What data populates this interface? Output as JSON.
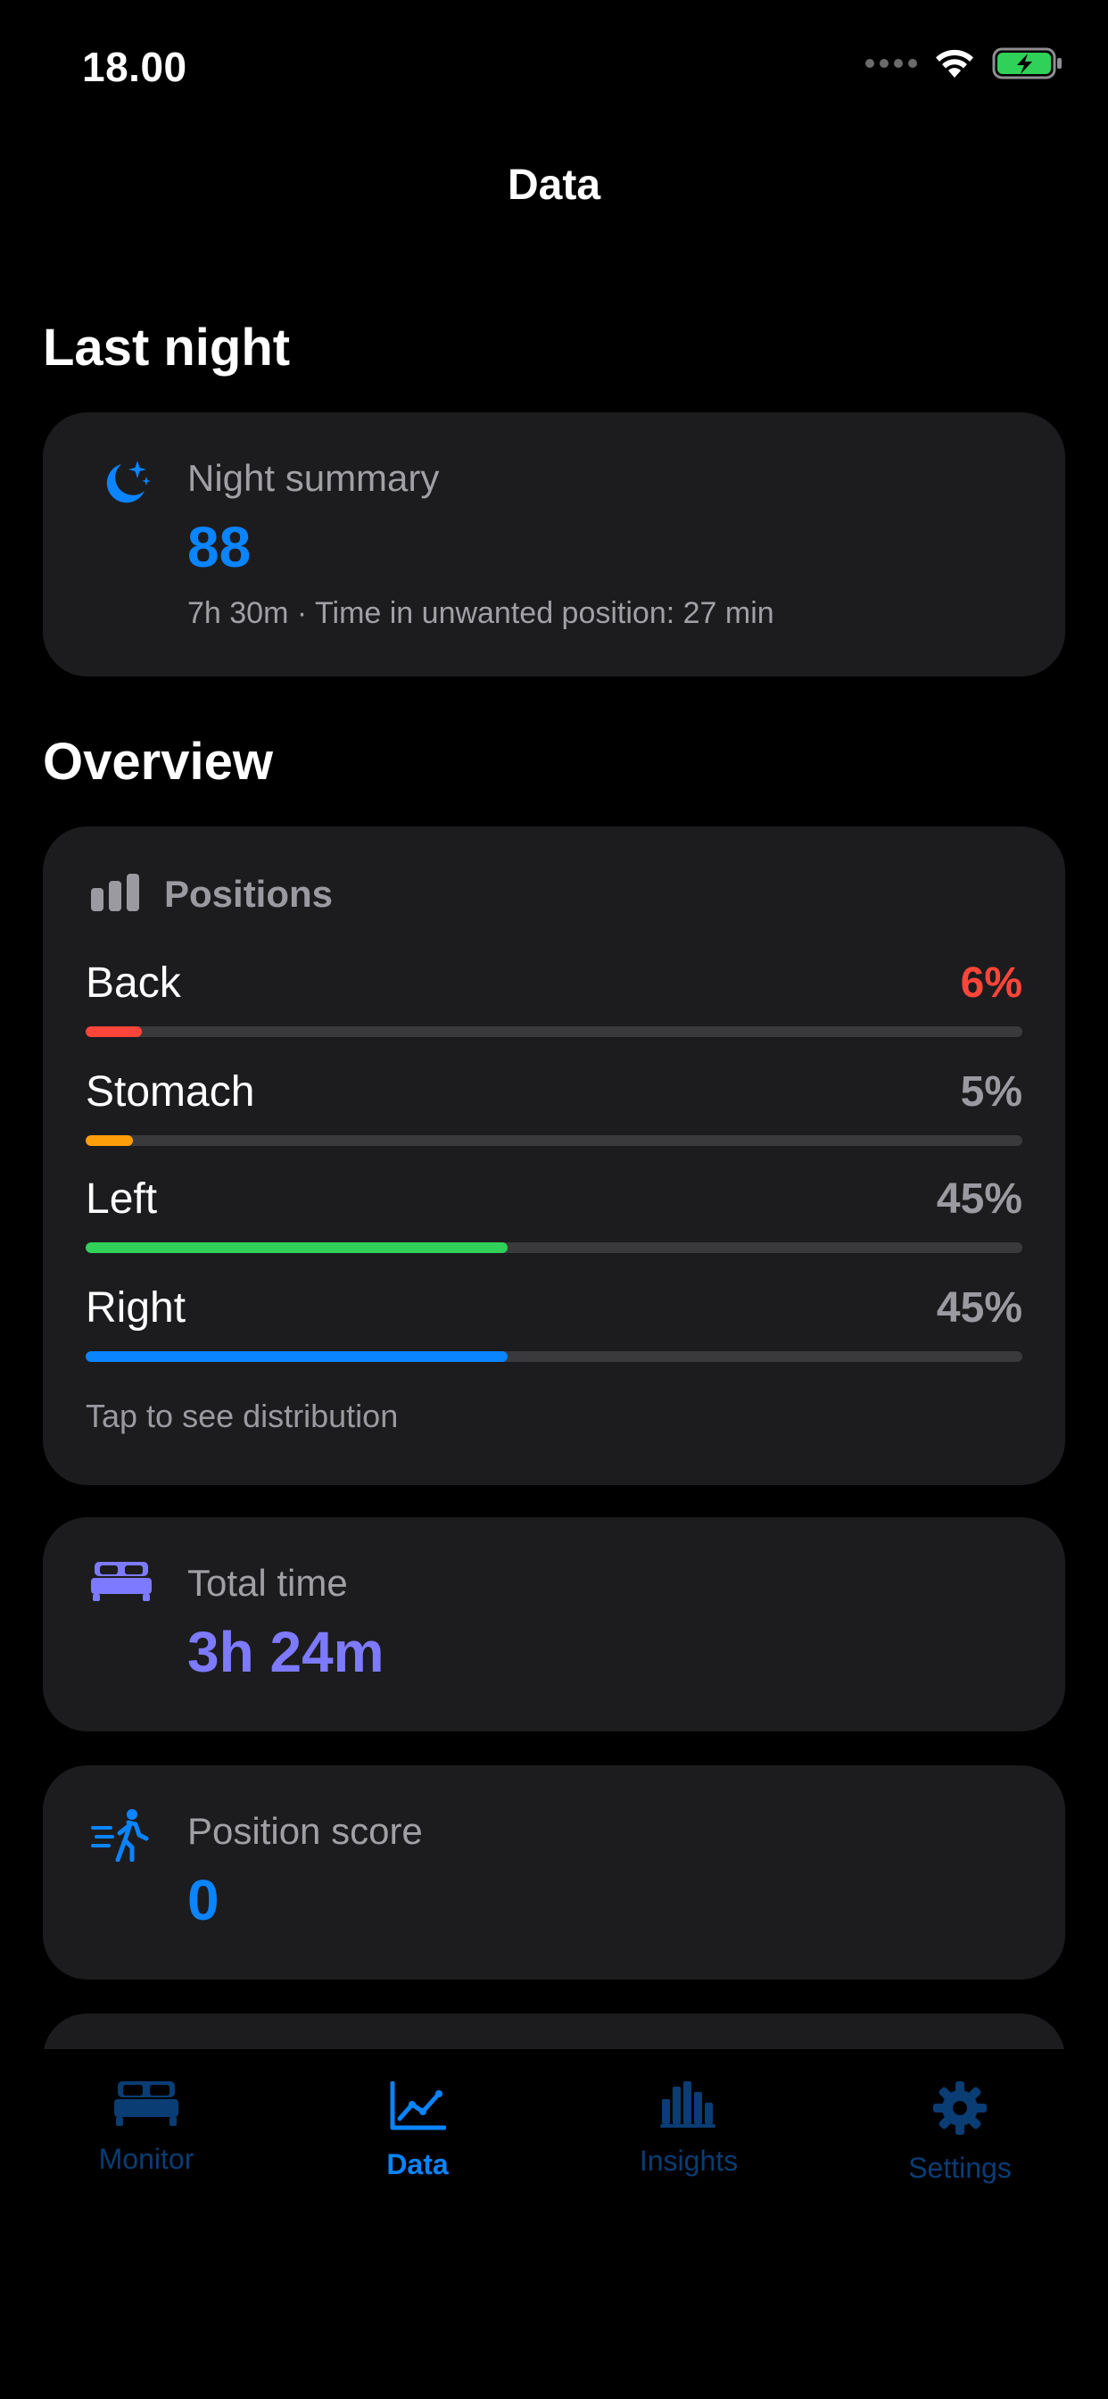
{
  "status_bar": {
    "time": "18.00"
  },
  "nav": {
    "title": "Data"
  },
  "sections": {
    "last_night": "Last night",
    "overview": "Overview"
  },
  "night_summary": {
    "label": "Night summary",
    "score": "88",
    "detail": "7h 30m · Time in unwanted position: 27 min",
    "icon": "moon-stars-icon"
  },
  "positions": {
    "title": "Positions",
    "icon": "bar-chart-icon",
    "hint": "Tap to see distribution",
    "items": [
      {
        "name": "Back",
        "percent_label": "6%",
        "value": 6,
        "color": "#ff453a",
        "label_color": "#ff453a"
      },
      {
        "name": "Stomach",
        "percent_label": "5%",
        "value": 5,
        "color": "#ff9f0a",
        "label_color": "#9a9aa0"
      },
      {
        "name": "Left",
        "percent_label": "45%",
        "value": 45,
        "color": "#30d158",
        "label_color": "#9a9aa0"
      },
      {
        "name": "Right",
        "percent_label": "45%",
        "value": 45,
        "color": "#0a84ff",
        "label_color": "#9a9aa0"
      }
    ]
  },
  "total_time": {
    "label": "Total time",
    "value": "3h 24m",
    "icon": "bed-icon",
    "color": "#7d7aff"
  },
  "position_score": {
    "label": "Position score",
    "value": "0",
    "icon": "person-walking-icon",
    "color": "#0a84ff"
  },
  "tabs": [
    {
      "label": "Monitor",
      "icon": "bed-icon",
      "active": false
    },
    {
      "label": "Data",
      "icon": "line-chart-icon",
      "active": true
    },
    {
      "label": "Insights",
      "icon": "bar-chart-icon",
      "active": false
    },
    {
      "label": "Settings",
      "icon": "gear-icon",
      "active": false
    }
  ],
  "colors": {
    "accent": "#0a84ff",
    "card": "#1c1c1e",
    "background": "#000000"
  }
}
